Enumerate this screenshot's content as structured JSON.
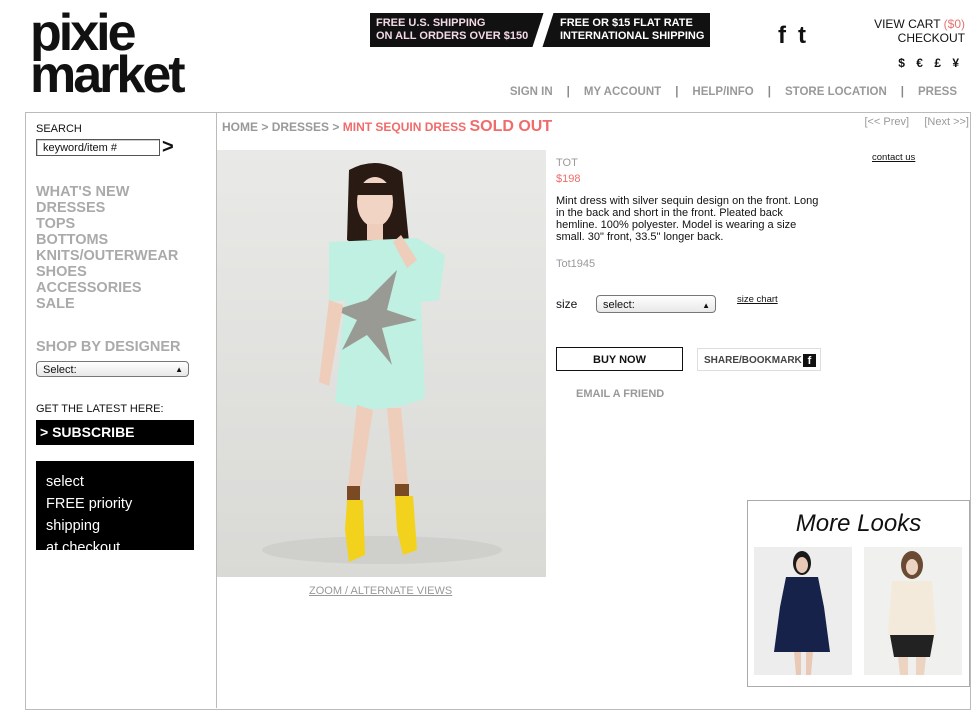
{
  "logo": {
    "line1": "pixie",
    "line2": "market"
  },
  "shipping_banner": {
    "left_line1": "FREE U.S. SHIPPING",
    "left_line2": "ON ALL ORDERS OVER $150",
    "right_line1": "FREE OR $15 FLAT RATE",
    "right_line2": "INTERNATIONAL SHIPPING"
  },
  "social": {
    "facebook": "f",
    "twitter": "t"
  },
  "cart": {
    "view_label": "VIEW CART",
    "amount": "($0)",
    "checkout": "CHECKOUT"
  },
  "currencies": "$ € £ ¥",
  "top_nav": [
    "SIGN IN",
    "MY ACCOUNT",
    "HELP/INFO",
    "STORE LOCATION",
    "PRESS"
  ],
  "sidebar": {
    "search_label": "SEARCH",
    "search_placeholder": "keyword/item #",
    "search_arrow": ">",
    "categories": [
      "WHAT'S NEW",
      "DRESSES",
      "TOPS",
      "BOTTOMS",
      "KNITS/OUTERWEAR",
      "SHOES",
      "ACCESSORIES",
      "SALE"
    ],
    "designer_heading": "SHOP BY DESIGNER",
    "designer_select": "Select:",
    "latest_label": "GET THE LATEST HERE:",
    "subscribe": "> SUBSCRIBE",
    "promo_line1": "select",
    "promo_line2": "FREE priority shipping",
    "promo_line3": "at checkout"
  },
  "breadcrumb": {
    "home": "HOME",
    "sep": ">",
    "category": "DRESSES",
    "current": "MINT SEQUIN DRESS",
    "status": "SOLD OUT"
  },
  "pager": {
    "prev": "[<< Prev]",
    "next": "[Next >>]"
  },
  "product": {
    "brand": "TOT",
    "price": "$198",
    "description": "Mint dress with silver sequin design on the front. Long in the back and short in the front. Pleated back hemline. 100% polyester. Model is wearing a size small. 30\" front, 33.5\" longer back.",
    "sku": "Tot1945",
    "size_label": "size",
    "size_select": "select:",
    "size_chart": "size chart",
    "buy_now": "BUY NOW",
    "share": "SHARE/BOOKMARK",
    "email_friend": "EMAIL A FRIEND",
    "contact_us": "contact us",
    "zoom_link": "ZOOM / ALTERNATE VIEWS"
  },
  "more_looks": {
    "title": "More Looks"
  },
  "colors": {
    "accent": "#f06b6b",
    "muted": "#999999",
    "dress": "#bff0e2",
    "boots": "#f2d21c"
  }
}
